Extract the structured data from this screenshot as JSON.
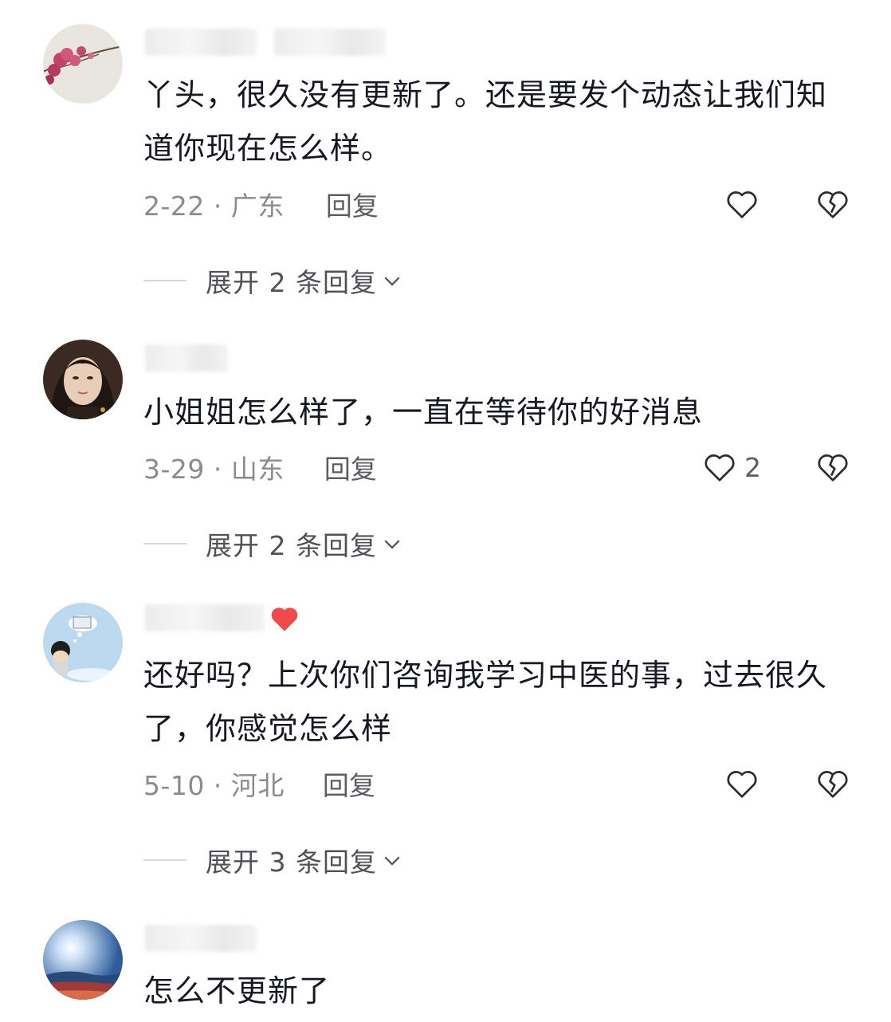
{
  "comments": [
    {
      "text": "丫头，很久没有更新了。还是要发个动态让我们知道你现在怎么样。",
      "date_location": "2-22 · 广东",
      "reply_label": "回复",
      "likes": "",
      "expand_label": "展开 2 条回复"
    },
    {
      "text": "小姐姐怎么样了，一直在等待你的好消息",
      "date_location": "3-29 · 山东",
      "reply_label": "回复",
      "likes": "2",
      "expand_label": "展开 2 条回复"
    },
    {
      "text": "还好吗？上次你们咨询我学习中医的事，过去很久了，你感觉怎么样",
      "date_location": "5-10 · 河北",
      "reply_label": "回复",
      "likes": "",
      "expand_label": "展开 3 条回复"
    },
    {
      "text": "怎么不更新了"
    }
  ],
  "icons": {
    "like": "heart-outline-icon",
    "dislike": "broken-heart-icon",
    "expand": "chevron-down-icon"
  },
  "colors": {
    "text": "#161823",
    "meta": "#8a8b91",
    "secondary": "#5c5d63"
  }
}
